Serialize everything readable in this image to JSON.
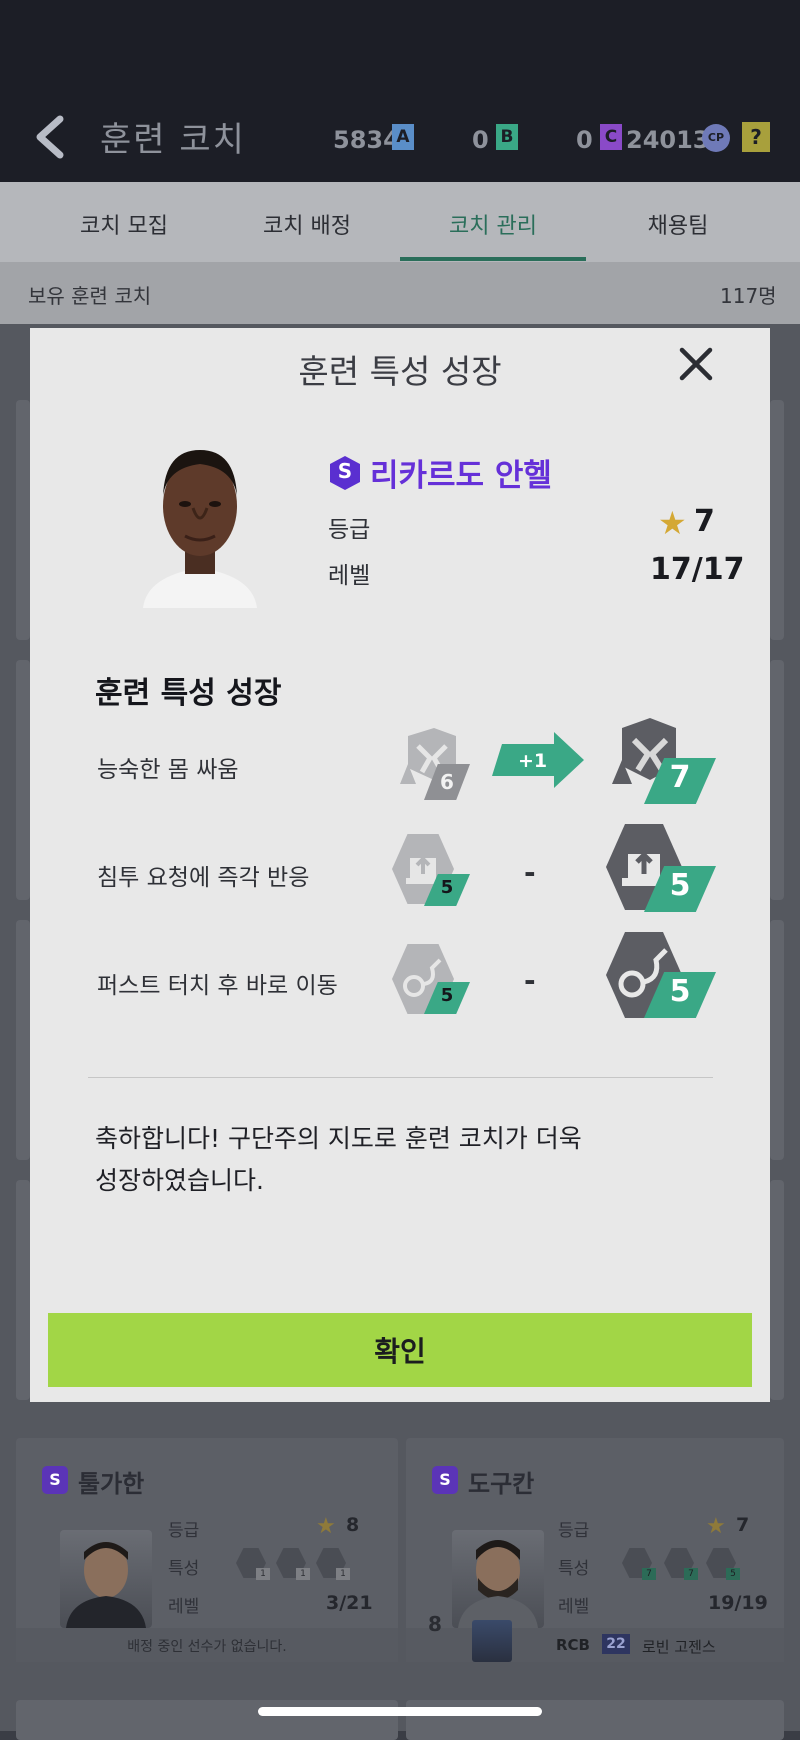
{
  "header": {
    "title": "훈련 코치",
    "currency_a_value": "5834",
    "currency_a_label": "A",
    "currency_b_value": "0",
    "currency_b_label": "B",
    "currency_c_value": "0",
    "currency_c_label": "C",
    "cp_value": "240130",
    "cp_label": "CP",
    "help_label": "?"
  },
  "tabs": [
    {
      "label": "코치 모집"
    },
    {
      "label": "코치 배정"
    },
    {
      "label": "코치 관리"
    },
    {
      "label": "채용팀"
    }
  ],
  "active_tab": "코치 관리",
  "subheader": {
    "label": "보유 훈련 코치",
    "count": "117명"
  },
  "modal": {
    "title": "훈련 특성 성장",
    "coach": {
      "grade_badge": "S",
      "name": "리카르도 안헬",
      "grade_label": "등급",
      "grade_value": "7",
      "level_label": "레벨",
      "level_value": "17/17"
    },
    "section_title": "훈련 특성 성장",
    "traits": [
      {
        "name": "능숙한 몸 싸움",
        "before": "6",
        "change": "+1",
        "after": "7"
      },
      {
        "name": "침투 요청에 즉각 반응",
        "before": "5",
        "change": "-",
        "after": "5"
      },
      {
        "name": "퍼스트 터치 후 바로 이동",
        "before": "5",
        "change": "-",
        "after": "5"
      }
    ],
    "message_line1": "축하합니다! 구단주의 지도로 훈련 코치가 더욱",
    "message_line2": "성장하였습니다.",
    "confirm_label": "확인"
  },
  "background_cards": [
    {
      "badge": "S",
      "name": "툴가한",
      "grade_label": "등급",
      "grade_value": "8",
      "trait_label": "특성",
      "trait_levels": [
        "1",
        "1",
        "1"
      ],
      "level_label": "레벨",
      "level_value": "3/21",
      "assignment": "배정 중인 선수가 없습니다."
    },
    {
      "badge": "S",
      "name": "도구칸",
      "grade_label": "등급",
      "grade_value": "7",
      "trait_label": "특성",
      "trait_levels": [
        "7",
        "7",
        "5"
      ],
      "level_label": "레벨",
      "level_value": "19/19",
      "assignment_number": "8",
      "assignment_position": "RCB",
      "assignment_ovr": "22",
      "assignment_player": "로빈 고젠스"
    }
  ],
  "colors": {
    "accent_green": "#a2d646",
    "teal": "#3aa886",
    "purple": "#6530d8",
    "star": "#d4a834"
  }
}
